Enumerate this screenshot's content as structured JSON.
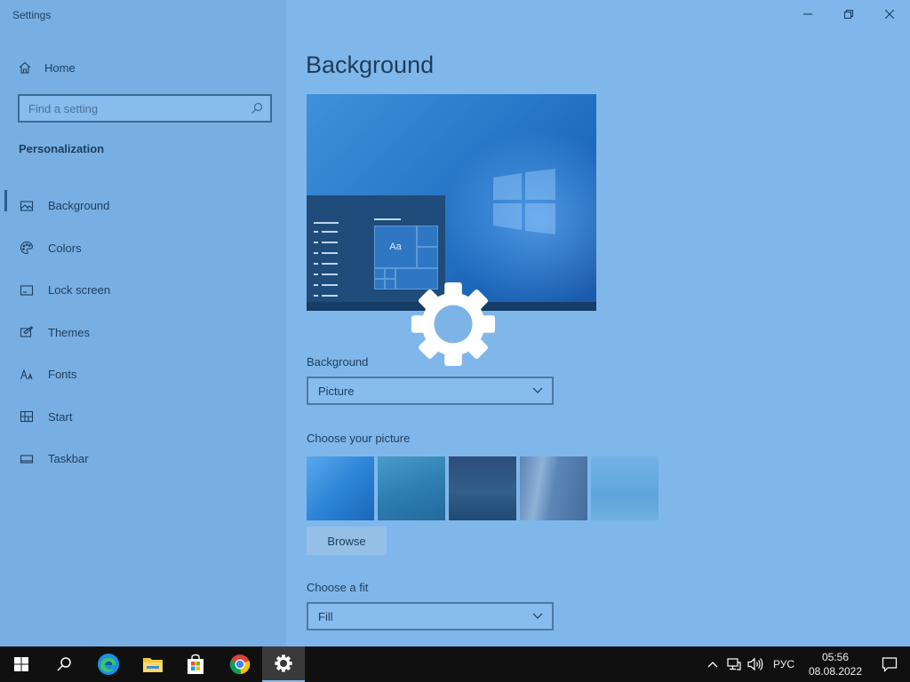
{
  "window": {
    "title": "Settings",
    "controls": [
      "minimize-icon",
      "restore-icon",
      "close-icon"
    ]
  },
  "sidebar": {
    "home_label": "Home",
    "search_placeholder": "Find a setting",
    "section_title": "Personalization",
    "items": [
      {
        "label": "Background",
        "icon": "picture-icon",
        "active": true
      },
      {
        "label": "Colors",
        "icon": "palette-icon"
      },
      {
        "label": "Lock screen",
        "icon": "lock-screen-icon"
      },
      {
        "label": "Themes",
        "icon": "themes-icon"
      },
      {
        "label": "Fonts",
        "icon": "fonts-icon"
      },
      {
        "label": "Start",
        "icon": "start-icon"
      },
      {
        "label": "Taskbar",
        "icon": "taskbar-icon"
      }
    ]
  },
  "main": {
    "title": "Background",
    "preview_tile_text": "Aa",
    "background_label": "Background",
    "background_value": "Picture",
    "choose_picture_label": "Choose your picture",
    "pictures": [
      "wallpaper-1",
      "wallpaper-2",
      "wallpaper-3",
      "wallpaper-4",
      "wallpaper-5"
    ],
    "browse_label": "Browse",
    "fit_label": "Choose a fit",
    "fit_value": "Fill"
  },
  "taskbar": {
    "apps": [
      "start-icon",
      "search-icon",
      "edge-icon",
      "file-explorer-icon",
      "store-icon",
      "chrome-icon",
      "settings-icon"
    ],
    "active_app": "settings-icon",
    "language": "РУС",
    "time": "05:56",
    "date": "08.08.2022"
  },
  "colors": {
    "overlay": "#80b7ea",
    "sidebar": "#78afe3",
    "taskbar": "#101010",
    "accent": "#2b5f91"
  }
}
